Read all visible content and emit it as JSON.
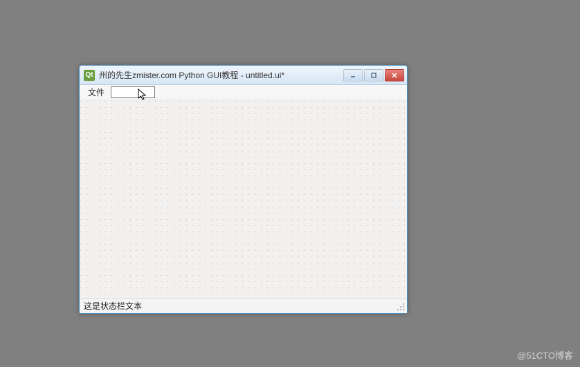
{
  "window": {
    "icon_letter": "Qt",
    "title": "州的先生zmister.com Python GUI教程 - untitled.ui*"
  },
  "menubar": {
    "file_label": "文件"
  },
  "statusbar": {
    "text": "这是状态栏文本"
  },
  "watermark": "@51CTO博客"
}
